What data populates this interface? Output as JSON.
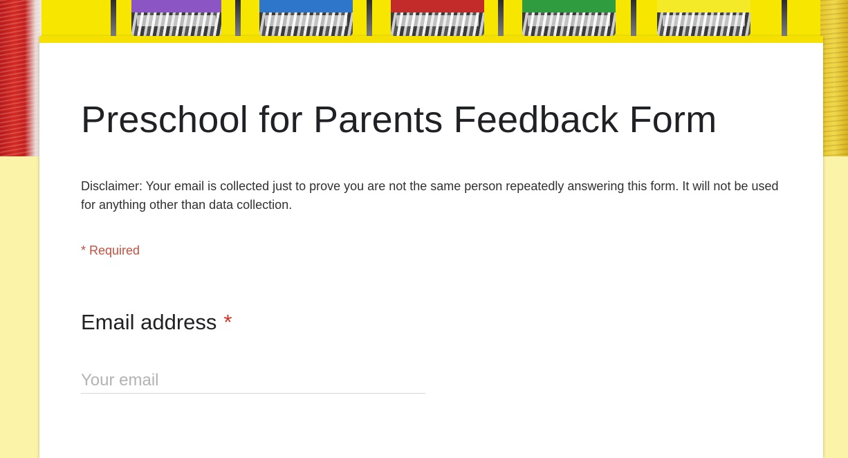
{
  "header": {
    "image": "crayons-banner"
  },
  "form": {
    "title": "Preschool for Parents Feedback Form",
    "description": "Disclaimer: Your email is collected just to prove you are not the same person repeatedly answering this form. It will not be used for anything other than data collection.",
    "required_note": "* Required",
    "questions": [
      {
        "title": "Email address",
        "required_marker": "*",
        "placeholder": "Your email",
        "value": ""
      }
    ]
  },
  "colors": {
    "page_background": "#fbf3a8",
    "accent": "#f5e000",
    "required": "#d93025"
  }
}
